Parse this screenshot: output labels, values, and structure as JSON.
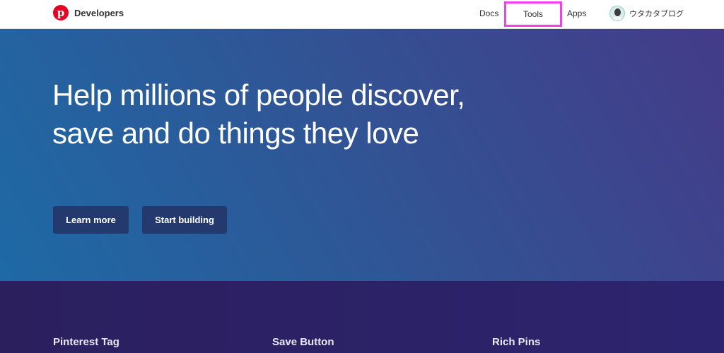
{
  "brand": {
    "name": "Developers",
    "logo_glyph": "p",
    "logo_color": "#e60023"
  },
  "nav": {
    "docs": "Docs",
    "tools": "Tools",
    "apps": "Apps",
    "highlight_color": "#f43ff0"
  },
  "user": {
    "name": "ウタカタブログ",
    "avatar_icon": "user-avatar"
  },
  "hero": {
    "title_line1": "Help millions of people discover,",
    "title_line2": "save and do things they love",
    "learn_more": "Learn more",
    "start_building": "Start building",
    "button_color": "#243a6e"
  },
  "features": [
    {
      "title": "Pinterest Tag"
    },
    {
      "title": "Save Button"
    },
    {
      "title": "Rich Pins"
    }
  ]
}
